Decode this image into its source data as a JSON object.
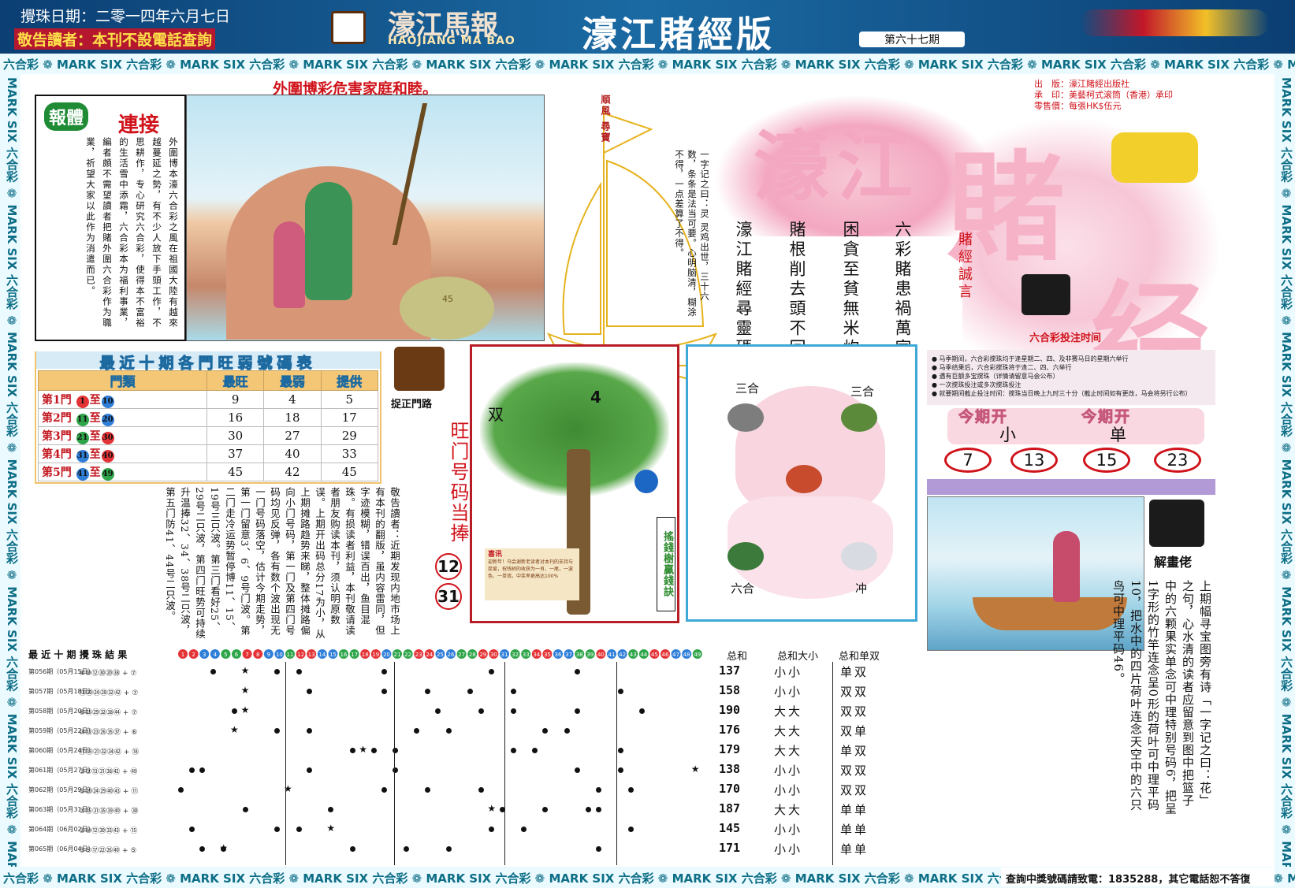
{
  "header": {
    "date": "攪珠日期：二零一四年六月七日",
    "notice": "敬告讀者：本刊不設電話查詢",
    "logo_cn": "濠江馬報",
    "logo_en": "HAOJIANG MA BAO",
    "edition": "濠江賭經版",
    "issue": "第六十七期"
  },
  "bands": {
    "unit": "六合彩 ❁ MARK SIX ",
    "top": "六合彩 ❁ MARK SIX 六合彩 ❁ MARK SIX 六合彩 ❁ MARK SIX 六合彩 ❁ MARK SIX 六合彩 ❁ MARK SIX 六合彩 ❁ MARK SIX 六合彩 ❁ MARK SIX 六合彩 ❁ MARK SIX 六合彩 ❁ MARK SIX 六合彩 ❁ MARK SIX 六合彩 ❁ MARK SIX",
    "side": "MARK SIX 六合彩 ❁ MARK SIX 六合彩 ❁ MARK SIX 六合彩 ❁ MARK SIX 六合彩 ❁ MARK SIX 六合彩 ❁ MARK SIX 六合彩 ❁ MARK SIX 六合彩 ❁ MARK SIX 六合彩 ❁ MARK SIX"
  },
  "phone_notice": "查詢中獎號碼請致電：1835288，其它電話恕不答復",
  "panel1": {
    "title": "外圍博彩危害家庭和睦。",
    "badge": "報體",
    "badge2": "連接",
    "text": "外圍博本濠六合彩之風在祖國大陸有越來越蔓延之勢，有不少人放下手頭工作，不思耕作，专心研究六合彩，使得本不富裕的生活雪中添霜，六合彩本为福利事業，編者頗不需望讀者把賭外圍六合彩作为職業，祈望大家以此作为消遣而已。",
    "rock_number": "45"
  },
  "ship": {
    "flag": "順風 尋寶",
    "text": "一字记之曰：灵 灵鸡出世，三十六数，条条是法当可要。心明脑清，糊涂不得，一点差算了不得。"
  },
  "proverb": {
    "col1": "六彩賭患禍萬家",
    "col2": "困貪至貧無米炊",
    "col3": "賭根削去頭不回",
    "col4": "濠江賭經尋靈碼",
    "col5": "賭經誠言"
  },
  "masthead": {
    "big1": "濠江",
    "big2": "賭",
    "big3": "经",
    "pubinfo": "出　版：濠江賭經出版社\n承　印：美藝柯式滚筒（香港）承印\n零售價：每張HK$伍元"
  },
  "bet_time": {
    "title": "六合彩投注时间",
    "text": "● 马季期间，六合彩搅珠均于逢星期二、四、及非赛马日的星期六举行\n● 马季结果后，六合彩搅珠将于逢二、四、六举行\n● 遇有巨额多宝搅珠（详情请留意马会公布）\n● 一次搅珠投注或多次搅珠投注\n● 就要期间截止投注时间：搅珠当日晚上九时三十分（截止时间如有更改，马会将另行公布）"
  },
  "hot_table": {
    "title": "最近十期各門旺弱號碼表",
    "headers": [
      "門類",
      "最旺",
      "最弱",
      "提供"
    ],
    "rows": [
      {
        "door": "第1門",
        "from": "1",
        "to": "10",
        "from_color": "red",
        "to_color": "blue",
        "hot": "9",
        "cold": "4",
        "offer": "5"
      },
      {
        "door": "第2門",
        "from": "11",
        "to": "20",
        "from_color": "green",
        "to_color": "blue",
        "hot": "16",
        "cold": "18",
        "offer": "17"
      },
      {
        "door": "第3門",
        "from": "21",
        "to": "30",
        "from_color": "green",
        "to_color": "red",
        "hot": "30",
        "cold": "27",
        "offer": "29"
      },
      {
        "door": "第4門",
        "from": "31",
        "to": "40",
        "from_color": "blue",
        "to_color": "red",
        "hot": "37",
        "cold": "40",
        "offer": "33"
      },
      {
        "door": "第5門",
        "from": "41",
        "to": "49",
        "from_color": "blue",
        "to_color": "green",
        "hot": "45",
        "cold": "42",
        "offer": "45"
      }
    ],
    "sep": "至"
  },
  "zhuozheng": {
    "label": "捉正門路",
    "notice": "敬告讀者：近期发现内地市场上有本刊的翻版，虽内容雷同，但字迹模糊，错误百出，鱼目混珠。有损读者利益，本刊敬请读者朋友购读本刊，须认明原数误。上期开出码总分17为小，从上期摊路趋势来睇，整体摊路偏向小门号码，第一门及第四门号码均见反弹，各有数个波出现无一门号码落空，估计今期走势，第一门留意3、6、9号门波。第二门走冷运势暂停博11、15、19号三只波。第三门看好25、29号二只波，第四门旺势可持续升温捧32、34、38号二只波，第五门防41、44号二只波。"
  },
  "hot_code": {
    "label": "旺门号码当捧",
    "n1": "12",
    "n2": "31"
  },
  "tree": {
    "shuang": "双",
    "num": "4",
    "tag": "搖錢樹贏錢訣",
    "slip_title": "喜讯",
    "slip": "迎新年！马会谢新老读者对本刊的支持与厚爱，祝钱树的收获为一肖、一尾，一波色、一单双。中奖率更高达100%"
  },
  "zodiac": {
    "top_left": "三合",
    "top_right": "三合",
    "bottom_left": "六合",
    "bottom_right": "冲"
  },
  "open": {
    "label1": "今期开",
    "label2": "今期开",
    "value1": "小",
    "value2": "单",
    "numbers": [
      "7",
      "13",
      "15",
      "23"
    ]
  },
  "jiehua": {
    "label": "解畫佬",
    "text": "上期幅寻宝图旁有诗「一字记之曰：花」之句，心水清的读者应留意到图中把篮子中的六颗果实单念可中理特别号码6，把呈1字形的竹竿连念呈0形的荷叶可中理平码10，把水中的四片荷叶连念天空中的六只鸟可中理平码46。"
  },
  "results": {
    "title": "最 近 十 期 攪 珠 結 果",
    "sum_headers": [
      "总和",
      "总和大小",
      "总和单双"
    ],
    "rows": [
      {
        "label": "第056期（05月15日）",
        "nums": "④⑩⑫㉚⑳㊳ + ⑦",
        "sum": "137",
        "size": "小小",
        "parity": "单双"
      },
      {
        "label": "第057期（05月18日）",
        "nums": "⑬⑳㉔㉘㉜㊷ + ⑦",
        "sum": "158",
        "size": "小小",
        "parity": "双双"
      },
      {
        "label": "第058期（05月20日）",
        "nums": "⑥㉕㉙㉜㊳㊹ + ⑦",
        "sum": "190",
        "size": "大大",
        "parity": "双双"
      },
      {
        "label": "第059期（05月22日）",
        "nums": "⑩⑬㉓㉖㉟㊲ + ⑥",
        "sum": "176",
        "size": "大大",
        "parity": "双单"
      },
      {
        "label": "第060期（05月24日）",
        "nums": "⑰⑲㉑㉜㉞㊷ + ⑱",
        "sum": "179",
        "size": "大大",
        "parity": "单双"
      },
      {
        "label": "第061期（05月27日）",
        "nums": "②③⑬㉑㊳㊷ + ㊾",
        "sum": "138",
        "size": "小小",
        "parity": "双双"
      },
      {
        "label": "第062期（05月29日）",
        "nums": "①⑳㉔㉙㊵㊸ + ⑪",
        "sum": "170",
        "size": "小小",
        "parity": "双双"
      },
      {
        "label": "第063期（05月31日）",
        "nums": "⑦⑮㉛㉟㊴㊵ + ㉚",
        "sum": "187",
        "size": "大大",
        "parity": "单单"
      },
      {
        "label": "第064期（06月02日）",
        "nums": "②⑩⑫㉚㉝㊸ + ⑮",
        "sum": "145",
        "size": "小小",
        "parity": "单单"
      },
      {
        "label": "第065期（06月04日）",
        "nums": "③⑤⑰㉒㉖㊵ + ⑤",
        "sum": "171",
        "size": "小小",
        "parity": "单单"
      }
    ]
  },
  "colors": {
    "red": "#d0131b",
    "navy": "#0b3f73",
    "pink": "#f6b3c7",
    "teal": "#0d6e86"
  }
}
